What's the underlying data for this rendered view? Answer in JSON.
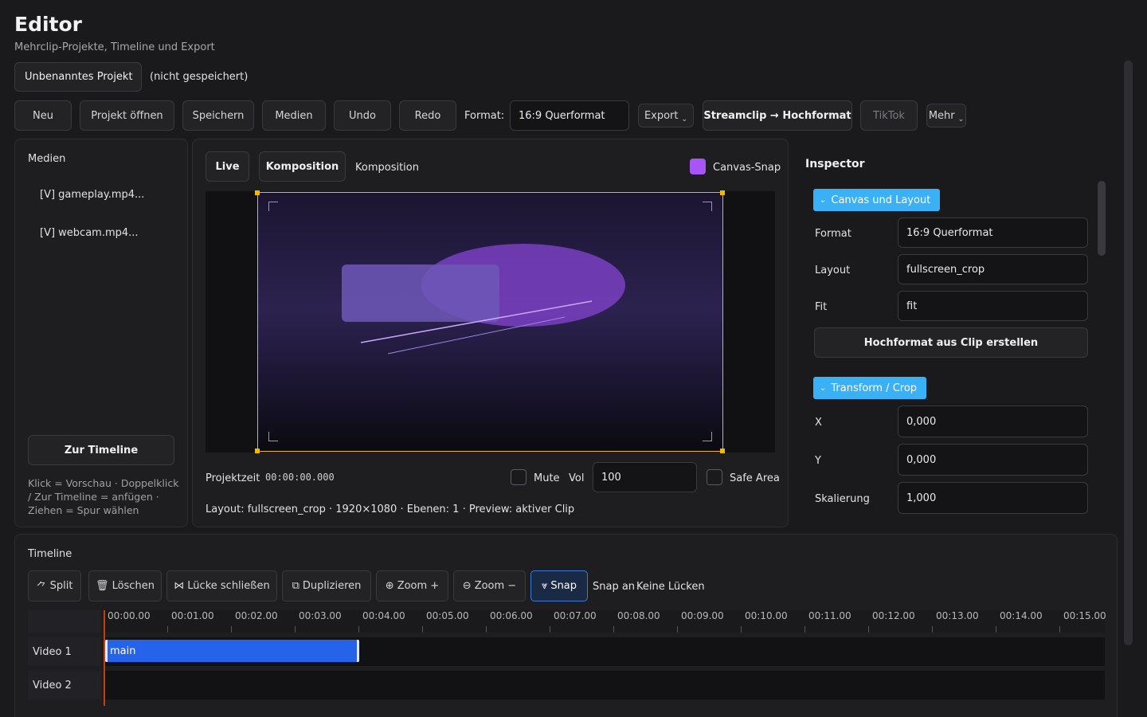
{
  "header": {
    "title": "Editor",
    "subtitle": "Mehrclip-Projekte, Timeline und Export"
  },
  "project": {
    "name": "Unbenanntes Projekt",
    "status": "(nicht gespeichert)"
  },
  "toolbar": {
    "new": "Neu",
    "open": "Projekt öffnen",
    "save": "Speichern",
    "media": "Medien",
    "undo": "Undo",
    "redo": "Redo",
    "format_label": "Format:",
    "format_value": "16:9 Querformat",
    "export": "Export",
    "streamclip": "Streamclip → Hochformat",
    "tiktok": "TikTok",
    "more": "Mehr"
  },
  "media_panel": {
    "title": "Medien",
    "items": [
      "[V] gameplay.mp4...",
      "[V] webcam.mp4..."
    ],
    "to_timeline": "Zur Timeline",
    "hint": "Klick = Vorschau · Doppelklick / Zur Timeline = anfügen · Ziehen = Spur wählen"
  },
  "preview": {
    "tab_live": "Live",
    "tab_komposition": "Komposition",
    "mode_label": "Komposition",
    "canvas_snap": "Canvas-Snap",
    "canvas_snap_color": "#a855f7",
    "projektzeit_label": "Projektzeit",
    "projektzeit_value": "00:00:00.000",
    "mute": "Mute",
    "vol_label": "Vol",
    "vol_value": "100",
    "safe_area": "Safe Area",
    "status": "Layout: fullscreen_crop · 1920×1080 · Ebenen: 1 · Preview: aktiver Clip"
  },
  "inspector": {
    "title": "Inspector",
    "section_canvas": "Canvas und Layout",
    "format_label": "Format",
    "format_value": "16:9 Querformat",
    "layout_label": "Layout",
    "layout_value": "fullscreen_crop",
    "fit_label": "Fit",
    "fit_value": "fit",
    "hochformat_button": "Hochformat aus Clip erstellen",
    "section_transform": "Transform / Crop",
    "x_label": "X",
    "x_value": "0,000",
    "y_label": "Y",
    "y_value": "0,000",
    "scale_label": "Skalierung",
    "scale_value": "1,000"
  },
  "timeline": {
    "title": "Timeline",
    "split": "Split",
    "delete": "Löschen",
    "close_gap": "Lücke schließen",
    "duplicate": "Duplizieren",
    "zoom_in": "Zoom +",
    "zoom_out": "Zoom −",
    "snap": "Snap",
    "snap_at": "Snap an",
    "no_gaps": "Keine Lücken",
    "ticks": [
      "00:00.00",
      "00:01.00",
      "00:02.00",
      "00:03.00",
      "00:04.00",
      "00:05.00",
      "00:06.00",
      "00:07.00",
      "00:08.00",
      "00:09.00",
      "00:10.00",
      "00:11.00",
      "00:12.00",
      "00:13.00",
      "00:14.00",
      "00:15.00"
    ],
    "tracks": [
      "Video 1",
      "Video 2"
    ],
    "clip_name": "main"
  },
  "colors": {
    "accent": "#3ab0f5",
    "clip": "#2563eb",
    "selection": "#f5b800",
    "playhead": "#c2410c"
  }
}
